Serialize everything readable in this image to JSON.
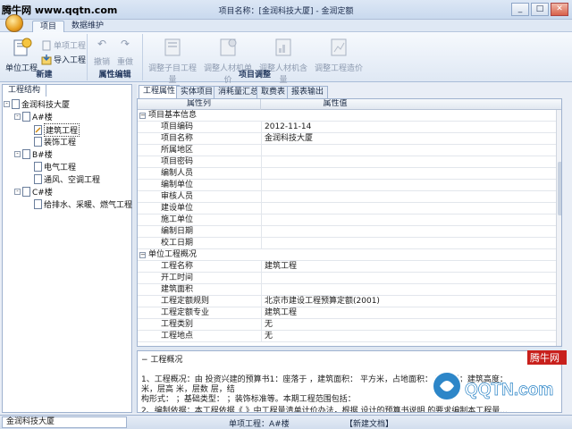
{
  "watermark": "腾牛网 www.qqtn.com",
  "window": {
    "title": "项目名称：[金润科技大厦] - 金润定额",
    "buttons": [
      "_",
      "□",
      "✕"
    ]
  },
  "menu": {
    "tabs": [
      {
        "label": "项目",
        "active": true
      },
      {
        "label": "数据维护",
        "active": false
      }
    ]
  },
  "ribbon": {
    "groups": [
      {
        "label": "新建",
        "big_button": "单位工程",
        "small_buttons": [
          "单项工程",
          "导入工程"
        ]
      },
      {
        "label": "属性编辑",
        "buttons": [
          "撤销",
          "重做"
        ]
      },
      {
        "label": "项目调整",
        "buttons": [
          "调整子目工程量",
          "调整人材机单价",
          "调整人材机含量",
          "调整工程造价"
        ]
      }
    ]
  },
  "left_panel": {
    "tab": "工程结构",
    "tree": [
      {
        "label": "金润科技大厦",
        "level": 0,
        "expander": "-"
      },
      {
        "label": "A#楼",
        "level": 1,
        "expander": "-"
      },
      {
        "label": "建筑工程",
        "level": 2,
        "selected": true
      },
      {
        "label": "装饰工程",
        "level": 2
      },
      {
        "label": "B#楼",
        "level": 1,
        "expander": "-"
      },
      {
        "label": "电气工程",
        "level": 2
      },
      {
        "label": "通风、空调工程",
        "level": 2
      },
      {
        "label": "C#楼",
        "level": 1,
        "expander": "-"
      },
      {
        "label": "给排水、采暖、燃气工程",
        "level": 2
      }
    ]
  },
  "right_tabs": [
    {
      "label": "工程属性",
      "active": true
    },
    {
      "label": "实体项目",
      "active": false
    },
    {
      "label": "消耗量汇总",
      "active": false
    },
    {
      "label": "取费表",
      "active": false
    },
    {
      "label": "报表输出",
      "active": false
    }
  ],
  "grid": {
    "columns": [
      "属性列",
      "属性值"
    ],
    "rows": [
      {
        "key": "项目基本信息",
        "value": "",
        "section": true
      },
      {
        "key": "项目编码",
        "value": "2012-11-14"
      },
      {
        "key": "项目名称",
        "value": "金润科技大厦"
      },
      {
        "key": "所属地区",
        "value": ""
      },
      {
        "key": "项目密码",
        "value": ""
      },
      {
        "key": "编制人员",
        "value": ""
      },
      {
        "key": "编制单位",
        "value": ""
      },
      {
        "key": "审核人员",
        "value": ""
      },
      {
        "key": "建设单位",
        "value": ""
      },
      {
        "key": "施工单位",
        "value": ""
      },
      {
        "key": "编制日期",
        "value": ""
      },
      {
        "key": "校工日期",
        "value": ""
      },
      {
        "key": "单位工程概况",
        "value": "",
        "section": true
      },
      {
        "key": "工程名称",
        "value": "建筑工程"
      },
      {
        "key": "开工时间",
        "value": ""
      },
      {
        "key": "建筑面积",
        "value": ""
      },
      {
        "key": "工程定额规则",
        "value": "北京市建设工程预算定额(2001)"
      },
      {
        "key": "工程定额专业",
        "value": "建筑工程"
      },
      {
        "key": "工程类别",
        "value": "无"
      },
      {
        "key": "工程地点",
        "value": "无"
      }
    ]
  },
  "description": {
    "title": "工程概况",
    "lines": [
      "1、工程概况：由        投资兴建的预算书1：座落于        ，建筑面积：        平方米，占地面积：        平方米；建筑高度：",
      "米，层高        米，层数        层，结",
      "构形式：        ；基础类型：        ；装饰标准等。本期工程范围包括：",
      "2、编制依据：本工程依据《        》中工程量清单计价办法，根据        设计的预算书说明        的要求编制本工程量..."
    ]
  },
  "status": {
    "project": "金润科技大厦",
    "unit": "单项工程：A#楼",
    "doc": "【新建文档】"
  },
  "badge": {
    "text": "腾牛网",
    "logo": "QQTN.com"
  },
  "colors": {
    "accent": "#dce7f5",
    "border": "#9fb2cf",
    "close": "#d8604a"
  }
}
